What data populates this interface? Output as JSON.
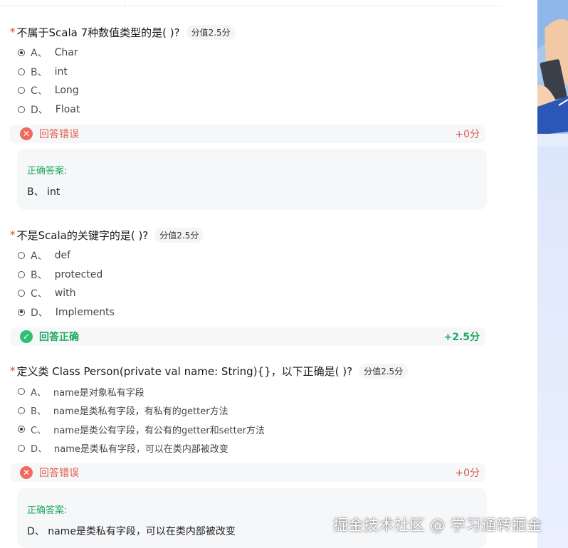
{
  "questions": [
    {
      "required_mark": "*",
      "title": "不属于Scala 7种数值类型的是( )?",
      "score_tag": "分值2.5分",
      "options": [
        {
          "letter": "A、",
          "text": "Char",
          "selected": true
        },
        {
          "letter": "B、",
          "text": "int",
          "selected": false
        },
        {
          "letter": "C、",
          "text": "Long",
          "selected": false
        },
        {
          "letter": "D、",
          "text": "Float",
          "selected": false
        }
      ],
      "result": {
        "status": "wrong",
        "label": "回答错误",
        "score": "+0分"
      },
      "correct_answer": {
        "label": "正确答案:",
        "text": "B、 int"
      }
    },
    {
      "required_mark": "*",
      "title": "不是Scala的关键字的是( )?",
      "score_tag": "分值2.5分",
      "options": [
        {
          "letter": "A、",
          "text": "def",
          "selected": false
        },
        {
          "letter": "B、",
          "text": "protected",
          "selected": false
        },
        {
          "letter": "C、",
          "text": "with",
          "selected": false
        },
        {
          "letter": "D、",
          "text": "Implements",
          "selected": true
        }
      ],
      "result": {
        "status": "right",
        "label": "回答正确",
        "score": "+2.5分"
      }
    },
    {
      "required_mark": "*",
      "title": "定义类 Class Person(private val name: String){}，以下正确是( )?",
      "score_tag": "分值2.5分",
      "options": [
        {
          "letter": "A、",
          "text": "name是对象私有字段",
          "selected": false
        },
        {
          "letter": "B、",
          "text": "name是类私有字段，有私有的getter方法",
          "selected": false
        },
        {
          "letter": "C、",
          "text": "name是类公有字段，有公有的getter和setter方法",
          "selected": true
        },
        {
          "letter": "D、",
          "text": "name是类私有字段，可以在类内部被改变",
          "selected": false
        }
      ],
      "result": {
        "status": "wrong",
        "label": "回答错误",
        "score": "+0分"
      },
      "correct_answer": {
        "label": "正确答案:",
        "text": "D、 name是类私有字段，可以在类内部被改变"
      }
    }
  ],
  "watermark": "掘金技术社区 @ 学习通转掘金",
  "icons": {
    "wrong": "close-circle-icon",
    "right": "check-circle-icon",
    "radio": "radio-button-icon"
  },
  "colors": {
    "wrong": "#e25b4f",
    "right": "#20a862",
    "required": "#e0493b"
  }
}
